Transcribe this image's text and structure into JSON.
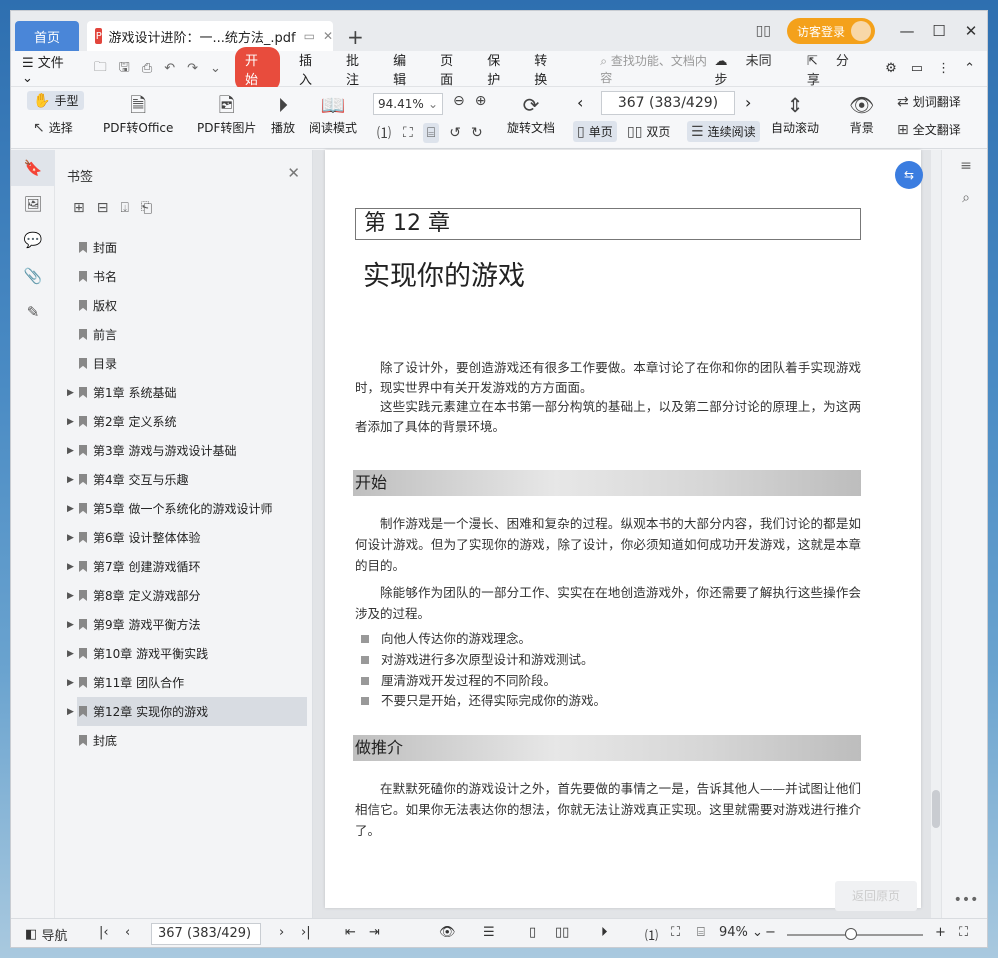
{
  "titlebar": {
    "home_tab": "首页",
    "doc_tab": "游戏设计进阶：一...统方法_.pdf",
    "new_tab": "+",
    "login": "访客登录"
  },
  "menu": {
    "file": "文件",
    "items": [
      "开始",
      "插入",
      "批注",
      "编辑",
      "页面",
      "保护",
      "转换"
    ],
    "search_placeholder": "查找功能、文档内容",
    "sync": "未同步",
    "share": "分享"
  },
  "ribbon": {
    "hand": "手型",
    "select": "选择",
    "pdf_to_office": "PDF转Office",
    "pdf_to_image": "PDF转图片",
    "play": "播放",
    "read_mode": "阅读模式",
    "zoom": "94.41%",
    "rotate": "旋转文档",
    "page_indicator": "367 (383/429)",
    "single": "单页",
    "double": "双页",
    "continuous": "连续阅读",
    "auto_scroll": "自动滚动",
    "background": "背景",
    "word_translate": "划词翻译",
    "full_translate": "全文翻译"
  },
  "bookmarks": {
    "title": "书签",
    "items": [
      {
        "label": "封面",
        "expandable": false
      },
      {
        "label": "书名",
        "expandable": false
      },
      {
        "label": "版权",
        "expandable": false
      },
      {
        "label": "前言",
        "expandable": false
      },
      {
        "label": "目录",
        "expandable": false
      },
      {
        "label": "第1章  系统基础",
        "expandable": true
      },
      {
        "label": "第2章  定义系统",
        "expandable": true
      },
      {
        "label": "第3章  游戏与游戏设计基础",
        "expandable": true
      },
      {
        "label": "第4章  交互与乐趣",
        "expandable": true
      },
      {
        "label": "第5章  做一个系统化的游戏设计师",
        "expandable": true
      },
      {
        "label": "第6章  设计整体体验",
        "expandable": true
      },
      {
        "label": "第7章  创建游戏循环",
        "expandable": true
      },
      {
        "label": "第8章  定义游戏部分",
        "expandable": true
      },
      {
        "label": "第9章  游戏平衡方法",
        "expandable": true
      },
      {
        "label": "第10章  游戏平衡实践",
        "expandable": true
      },
      {
        "label": "第11章  团队合作",
        "expandable": true
      },
      {
        "label": "第12章  实现你的游戏",
        "expandable": true,
        "selected": true
      },
      {
        "label": "封底",
        "expandable": false
      }
    ]
  },
  "page": {
    "chapter_num": "第 12 章",
    "chapter_title": "实现你的游戏",
    "intro1": "除了设计外，要创造游戏还有很多工作要做。本章讨论了在你和你的团队着手实现游戏时，现实世界中有关开发游戏的方方面面。",
    "intro2": "这些实践元素建立在本书第一部分构筑的基础上，以及第二部分讨论的原理上，为这两者添加了具体的背景环境。",
    "section1": "开始",
    "p1": "制作游戏是一个漫长、困难和复杂的过程。纵观本书的大部分内容，我们讨论的都是如何设计游戏。但为了实现你的游戏，除了设计，你必须知道如何成功开发游戏，这就是本章的目的。",
    "p2": "除能够作为团队的一部分工作、实实在在地创造游戏外，你还需要了解执行这些操作会涉及的过程。",
    "bullets": [
      "向他人传达你的游戏理念。",
      "对游戏进行多次原型设计和游戏测试。",
      "厘清游戏开发过程的不同阶段。",
      "不要只是开始，还得实际完成你的游戏。"
    ],
    "section2": "做推介",
    "p3": "在默默死磕你的游戏设计之外，首先要做的事情之一是，告诉其他人——并试图让他们相信它。如果你无法表达你的想法，你就无法让游戏真正实现。这里就需要对游戏进行推介了。"
  },
  "hidden_button": "返回原页",
  "status": {
    "nav": "导航",
    "page": "367 (383/429)",
    "zoom": "94%"
  }
}
